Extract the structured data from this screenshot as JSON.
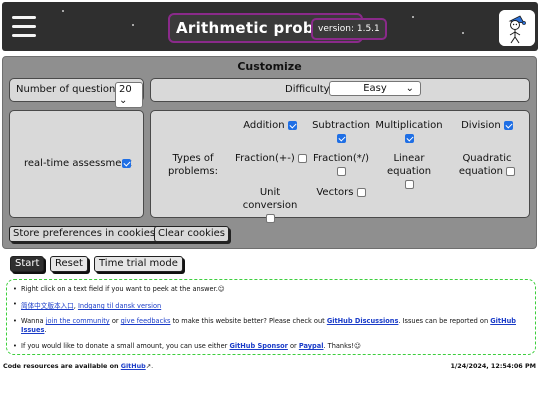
{
  "header": {
    "title": "Arithmetic problems",
    "version": "version: 1.5.1"
  },
  "customize": {
    "title": "Customize",
    "num_questions_label": "Number of questions",
    "num_questions_value": "20",
    "difficulty_label": "Difficulty",
    "difficulty_value": "Easy",
    "realtime_label": "real-time assessment",
    "realtime_checked": true,
    "types_label": "Types of problems:",
    "types": [
      {
        "label": "Addition",
        "checked": true
      },
      {
        "label": "Subtraction",
        "checked": true
      },
      {
        "label": "Multiplication",
        "checked": true
      },
      {
        "label": "Division",
        "checked": true
      },
      {
        "label": "Fraction(+-)",
        "checked": false
      },
      {
        "label": "Fraction(*/)",
        "checked": false
      },
      {
        "label": "Linear equation",
        "checked": false
      },
      {
        "label": "Quadratic equation",
        "checked": false
      },
      {
        "label": "Unit conversion",
        "checked": false
      },
      {
        "label": "Vectors",
        "checked": false
      }
    ],
    "store_button": "Store preferences in cookies",
    "clear_button": "Clear cookies"
  },
  "actions": {
    "start": "Start",
    "reset": "Reset",
    "time_trial": "Time trial mode"
  },
  "info": {
    "line1": "Right click on a text field if you want to peek at the answer.",
    "line1_emoji": "☺",
    "lang_zh": "简体中文版本入口",
    "lang_da": "Indgang til dansk version",
    "line3_pre": "Wanna ",
    "join_link": "join the community",
    "line3_or": " or ",
    "feedback_link": "give feedbacks",
    "line3_mid": " to make this website better? Please check out ",
    "discussions_link": "GitHub Discussions",
    "line3_post": ". Issues can be reported on ",
    "issues_link": "GitHub Issues",
    "line3_end": ".",
    "line4_pre": "If you would like to donate a small amount, you can use either ",
    "sponsor_link": "GitHub Sponsor",
    "line4_or": " or ",
    "paypal_link": "Paypal",
    "line4_end": ". Thanks!☺"
  },
  "footer": {
    "code_pre": "Code resources are available on ",
    "github_link": "GitHub",
    "ext_icon": "↗",
    "code_end": ".",
    "datetime": "1/24/2024, 12:54:06 PM"
  },
  "colors": {
    "header_bg": "#2f2f2f",
    "accent": "#8a2a8a",
    "panel_bg": "#8f8f8f",
    "box_bg": "#d9d9d9",
    "info_border": "#3ccf3c",
    "link": "#1a3cc8",
    "checkbox_on": "#1f6fe5"
  },
  "icons": {
    "menu": "hamburger-icon",
    "avatar": "stick-figure-avatar-icon",
    "select_arrow": "chevron-down-icon",
    "external": "external-link-icon"
  }
}
